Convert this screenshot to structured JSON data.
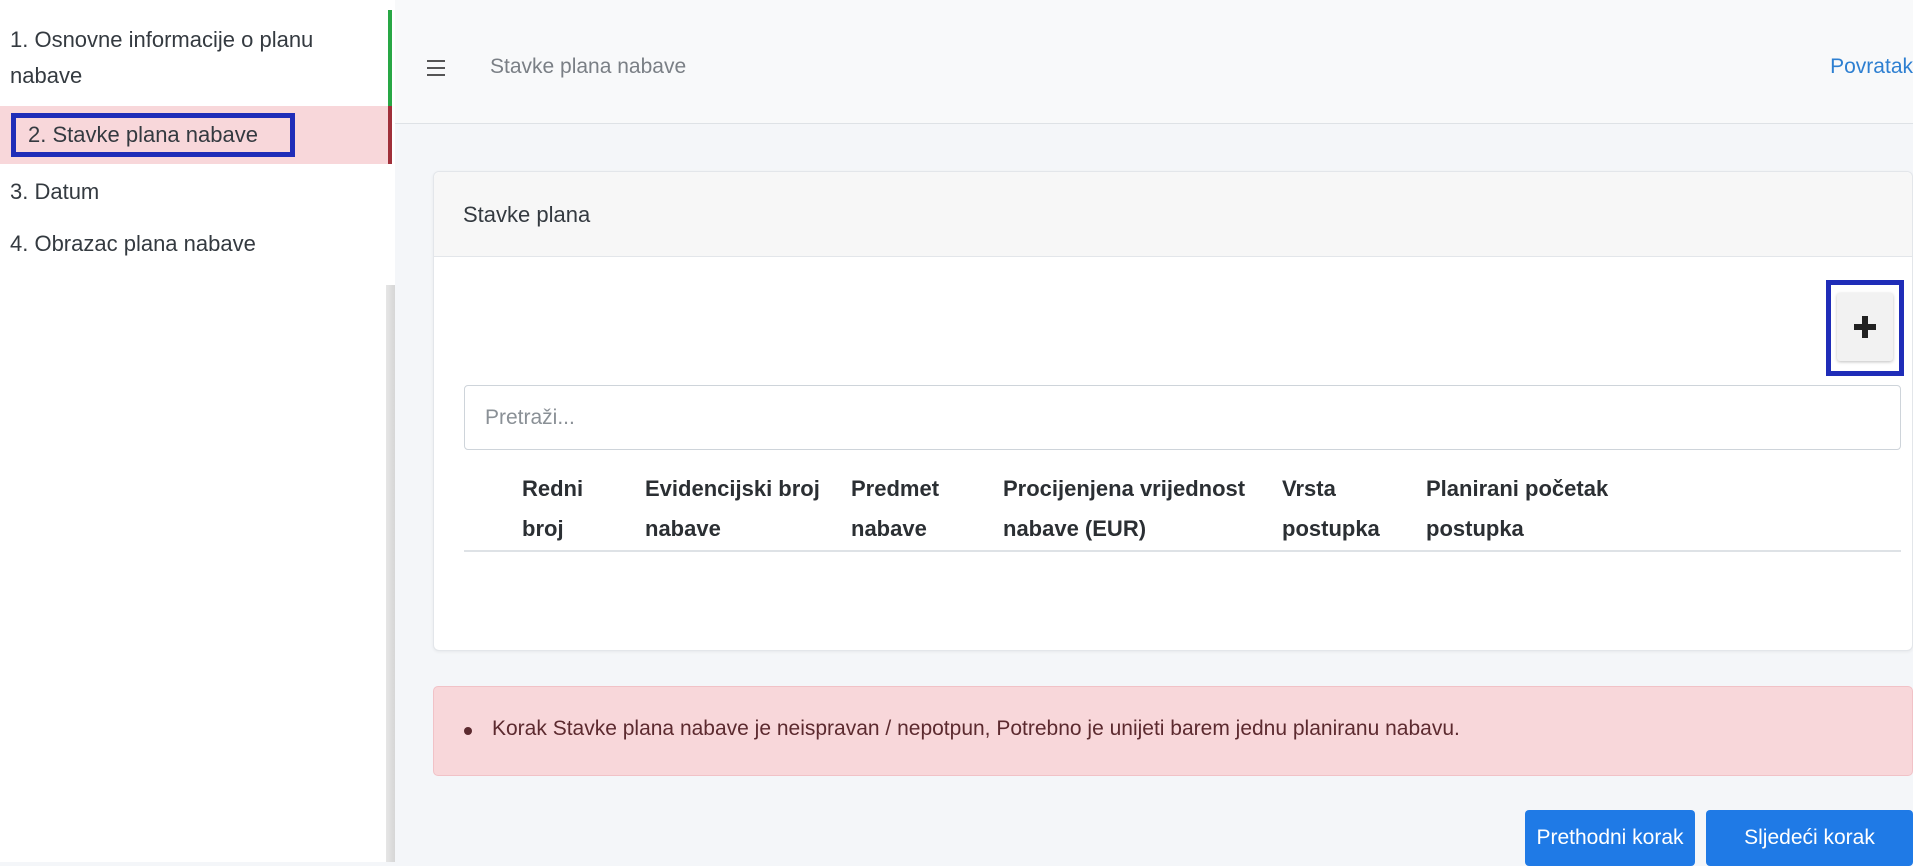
{
  "sidebar": {
    "steps": [
      {
        "label": "1. Osnovne informacije o planu nabave"
      },
      {
        "label": "2. Stavke plana nabave"
      },
      {
        "label": "3. Datum"
      },
      {
        "label": "4. Obrazac plana nabave"
      }
    ],
    "active_index": 1,
    "completed_color": "#28a745",
    "active_bg": "#f8d7da"
  },
  "topbar": {
    "menu_icon": "hamburger-menu-icon",
    "title": "Stavke plana nabave",
    "back_link": "Povratak"
  },
  "card": {
    "title": "Stavke plana",
    "add_icon": "plus-icon",
    "search": {
      "placeholder": "Pretraži...",
      "value": ""
    },
    "table": {
      "columns": [
        "Redni broj",
        "Evidencijski broj nabave",
        "Predmet nabave",
        "Procijenjena vrijednost nabave (EUR)",
        "Vrsta postupka",
        "Planirani početak postupka"
      ],
      "rows": []
    }
  },
  "alert": {
    "message": "Korak Stavke plana nabave je neispravan / nepotpun, Potrebno je unijeti barem jednu planiranu nabavu."
  },
  "nav": {
    "prev_label": "Prethodni korak",
    "next_label": "Sljedeći korak"
  },
  "colors": {
    "primary": "#1f7ae6",
    "highlight": "#1f2db8",
    "link": "#2d7fd1"
  }
}
